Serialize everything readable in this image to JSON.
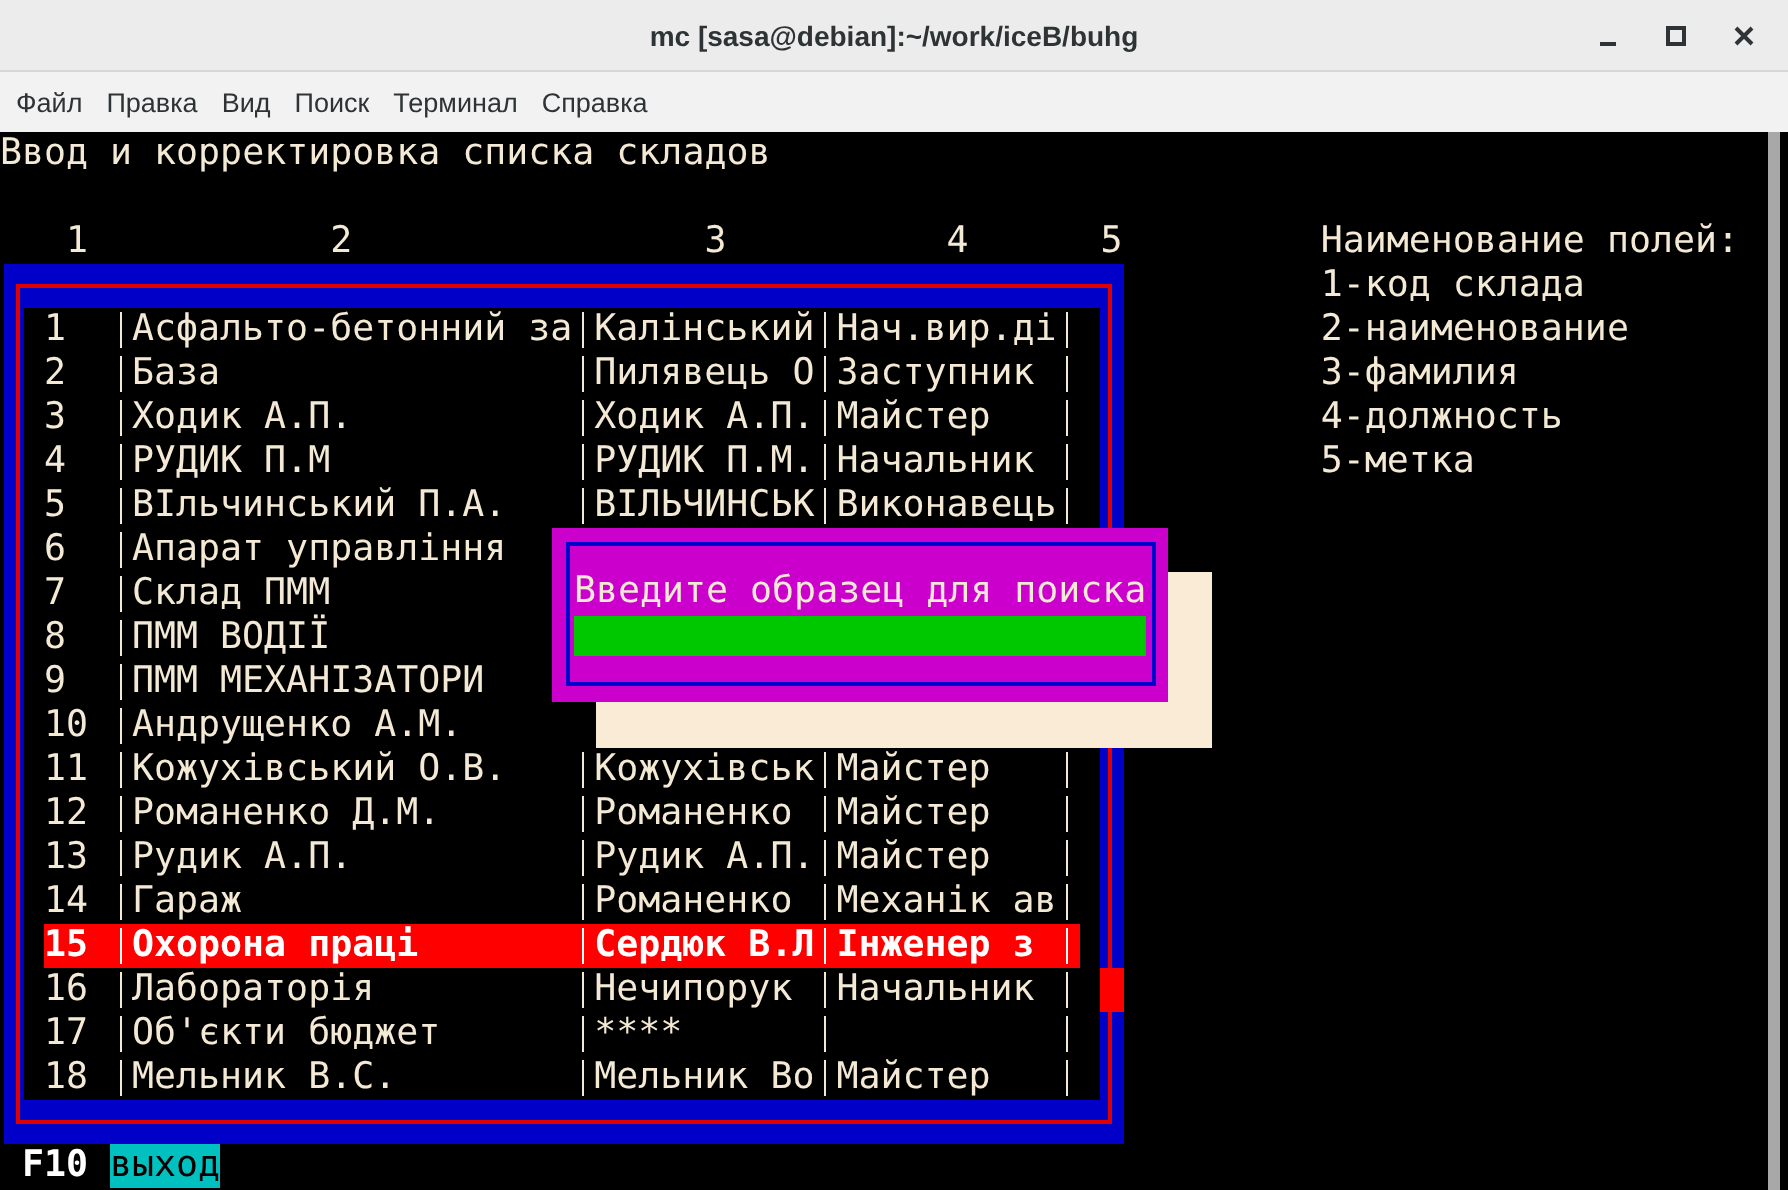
{
  "window": {
    "title": "mc [sasa@debian]:~/work/iceB/buhg"
  },
  "menu": [
    "Файл",
    "Правка",
    "Вид",
    "Поиск",
    "Терминал",
    "Справка"
  ],
  "screen_title": "Ввод и корректировка списка складов",
  "column_numbers": [
    "1",
    "2",
    "3",
    "4",
    "5"
  ],
  "rows": [
    {
      "code": "1",
      "name": "Асфальто-бетонний за",
      "surname": "Калінський",
      "position": "Нач.вир.ді",
      "selected": false
    },
    {
      "code": "2",
      "name": "База",
      "surname": "Пилявець О",
      "position": "Заступник",
      "selected": false
    },
    {
      "code": "3",
      "name": "Ходик А.П.",
      "surname": "Ходик А.П.",
      "position": "Майстер",
      "selected": false
    },
    {
      "code": "4",
      "name": "РУДИК П.М",
      "surname": "РУДИК П.М.",
      "position": "Начальник",
      "selected": false
    },
    {
      "code": "5",
      "name": "ВІльчинський П.А.",
      "surname": "ВІЛЬЧИНСЬК",
      "position": "Виконавець",
      "selected": false
    },
    {
      "code": "6",
      "name": "Апарат управління",
      "selected": false
    },
    {
      "code": "7",
      "name": "Склад ПММ",
      "selected": false
    },
    {
      "code": "8",
      "name": "ПММ ВОДІЇ",
      "selected": false
    },
    {
      "code": "9",
      "name": "ПММ МЕХАНІЗАТОРИ",
      "selected": false
    },
    {
      "code": "10",
      "name": "Андрущенко А.М.",
      "selected": false
    },
    {
      "code": "11",
      "name": "Кожухівський О.В.",
      "surname": "Кожухівськ",
      "position": "Майстер",
      "selected": false
    },
    {
      "code": "12",
      "name": "Романенко Д.М.",
      "surname": "Романенко",
      "position": "Майстер",
      "selected": false
    },
    {
      "code": "13",
      "name": "Рудик А.П.",
      "surname": "Рудик А.П.",
      "position": "Майстер",
      "selected": false
    },
    {
      "code": "14",
      "name": "Гараж",
      "surname": "Романенко",
      "position": "Механік ав",
      "selected": false
    },
    {
      "code": "15",
      "name": "Охорона праці",
      "surname": "Сердюк В.Л",
      "position": "Інженер з",
      "selected": true
    },
    {
      "code": "16",
      "name": "Лабораторія",
      "surname": "Нечипорук",
      "position": "Начальник",
      "selected": false
    },
    {
      "code": "17",
      "name": "Об'єкти бюджет",
      "surname": "****",
      "selected": false
    },
    {
      "code": "18",
      "name": "Мельник В.С.",
      "surname": "Мельник Во",
      "position": "Майстер",
      "selected": false
    }
  ],
  "legend": {
    "title": "Наименование полей:",
    "items": [
      "1-код склада",
      "2-наименование",
      "3-фамилия",
      "4-должность",
      "5-метка"
    ]
  },
  "dialog": {
    "prompt": "Введите образец для поиска"
  },
  "hotkeys": [
    {
      "key": "F10",
      "label": "выход"
    }
  ]
}
